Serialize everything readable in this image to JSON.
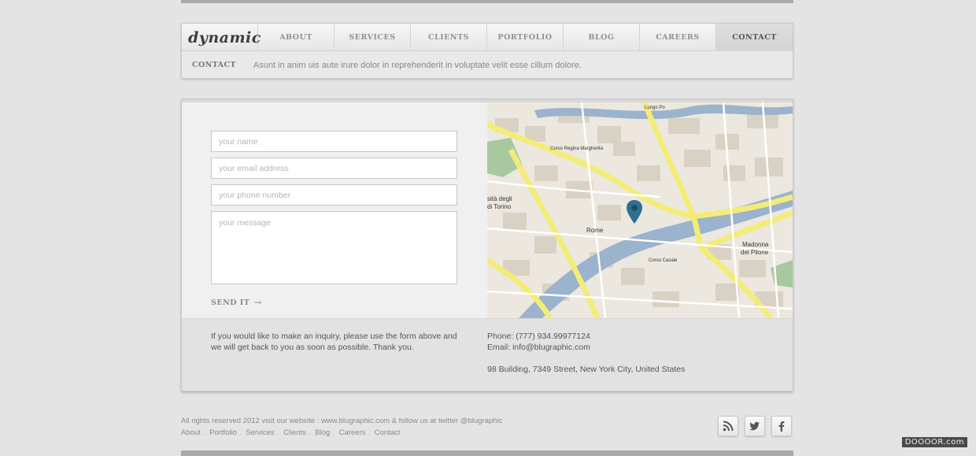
{
  "logo": {
    "text": "dynamic"
  },
  "nav": {
    "items": [
      "ABOUT",
      "SERVICES",
      "CLIENTS",
      "PORTFOLIO",
      "BLOG",
      "CAREERS",
      "CONTACT"
    ],
    "active": "CONTACT"
  },
  "subheader": {
    "crumb": "CONTACT",
    "tagline": "Asunt in anim uis aute irure dolor in reprehenderit in voluptate velit esse cillum dolore."
  },
  "form": {
    "name_placeholder": "your name",
    "email_placeholder": "your email address",
    "phone_placeholder": "your phone number",
    "message_placeholder": "your message",
    "send_label": "SEND IT",
    "send_arrow": "→"
  },
  "map": {
    "labels": [
      "sità degli",
      "di Torino",
      "Rome",
      "Madonna",
      "del Pilone",
      "Corso Regina Margherita",
      "Corso Casale",
      "Lungo Po"
    ]
  },
  "info": {
    "inquiry": "If you would like to make an inquiry, please use the form above and we will get back to you as soon as possible. Thank you.",
    "phone": "Phone: (777) 934.99977124",
    "email": "Email: info@blugraphic.com",
    "address": "98 Building, 7349 Street, New York City, United States"
  },
  "footer": {
    "copyright": "All rights reserved 2012   visit our website : www.blugraphic.com  &  follow us at twitter @blugraphic",
    "links": [
      "About",
      "Portfolio",
      "Services",
      "Clients",
      "Blog",
      "Careers",
      "Contact"
    ]
  },
  "social": [
    "rss-icon",
    "twitter-icon",
    "facebook-icon"
  ],
  "watermark": "DOOOOR.com",
  "colors": {
    "background": "#e4e4e4",
    "river": "#9bb3cc",
    "road": "#f3ec76",
    "park": "#a8c8a0"
  }
}
